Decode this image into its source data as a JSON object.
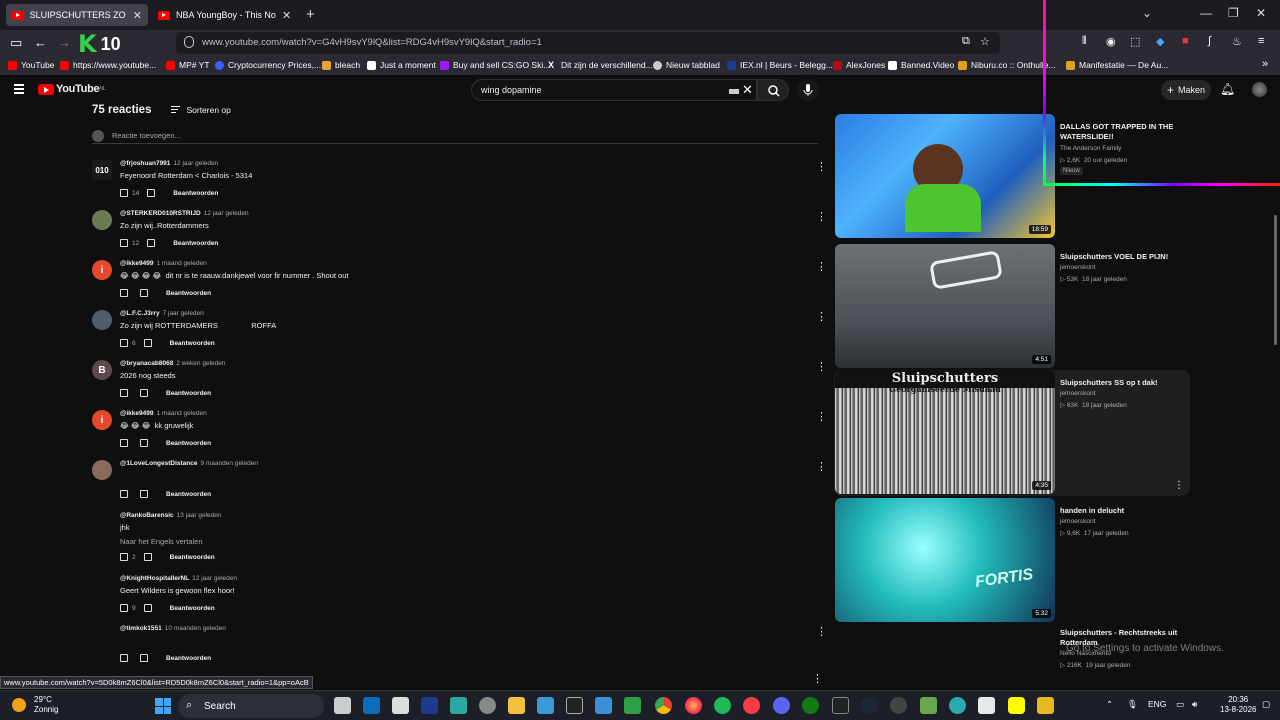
{
  "browser": {
    "tabs": [
      {
        "title": "SLUIPSCHUTTERS ZO ZIJN",
        "active": true
      },
      {
        "title": "NBA YoungBoy - This Not a Song",
        "active": false
      }
    ],
    "url": "www.youtube.com/watch?v=G4vH9svY9lQ&list=RDG4vH9svY9lQ&start_radio=1",
    "k_badge_number": "10",
    "bookmarks": [
      {
        "label": "YouTube",
        "color": "#ff0000"
      },
      {
        "label": "https://www.youtube...",
        "color": "#ff0000"
      },
      {
        "label": "MP# YT",
        "color": "#ff0000"
      },
      {
        "label": "Cryptocurrency Prices,...",
        "color": "#3861fb"
      },
      {
        "label": "bleach",
        "color": "#e8a33a"
      },
      {
        "label": "Just a moment",
        "color": "#ffffff"
      },
      {
        "label": "Buy and sell CS:GO Ski...",
        "color": "#9c1cff"
      },
      {
        "label": "Dit zijn de verschillend...",
        "color": "#ffffff"
      },
      {
        "label": "Nieuw tabblad",
        "color": "#cccccc"
      },
      {
        "label": "IEX.nl | Beurs - Belegg...",
        "color": "#1a3d8f"
      },
      {
        "label": "AlexJones",
        "color": "#b01010"
      },
      {
        "label": "Banned.Video",
        "color": "#ffffff"
      },
      {
        "label": "Niburu.co :: Onthulle...",
        "color": "#e0a020"
      },
      {
        "label": "Manifestatie — De Au...",
        "color": "#e0a020"
      }
    ],
    "hover_url": "www.youtube.com/watch?v=5D0k8mZ6Cl0&list=RD5D0k8mZ6Cl0&start_radio=1&pp=oAcB"
  },
  "youtube": {
    "logo": "YouTube",
    "logo_country": "NL",
    "search_query": "wing dopamine",
    "create_label": "Maken"
  },
  "comments": {
    "count_label": "75 reacties",
    "sort_label": "Sorteren op",
    "add_placeholder": "Reactie toevoegen...",
    "reply_label": "Beantwoorden",
    "items": [
      {
        "handle": "@frjoshuan7991",
        "time": "12 jaar geleden",
        "text": "Feyenoord Rotterdam < Charlois - 5314",
        "likes": "14",
        "avatar": "010",
        "avatar_color": "#1a1a1a"
      },
      {
        "handle": "@STERKERD010RSTRIJD",
        "time": "12 jaar geleden",
        "text": "Zo zijn wij..Rotterdammers",
        "likes": "12",
        "avatar": "",
        "avatar_color": "#6b7a55"
      },
      {
        "handle": "@ikke9499",
        "time": "1 maand geleden",
        "text": "😂 😂 😂 😂  dit nr is te raauw.dankjewel voor fir nummer . Shout out",
        "likes": "",
        "avatar": "i",
        "avatar_color": "#e5482c"
      },
      {
        "handle": "@L.F.C.J3rry",
        "time": "7 jaar geleden",
        "text": "Zo zijn wij ROTTERDAMERS                ROFFA",
        "likes": "6",
        "avatar": "",
        "avatar_color": "#4d5b6b"
      },
      {
        "handle": "@bryanacab8068",
        "time": "2 weken geleden",
        "text": "2026 nog steeds",
        "likes": "",
        "avatar": "B",
        "avatar_color": "#5e4a4a"
      },
      {
        "handle": "@ikke9499",
        "time": "1 maand geleden",
        "text": "😂 😂 😂  kk gruwelijk",
        "likes": "",
        "avatar": "i",
        "avatar_color": "#e5482c"
      },
      {
        "handle": "@1LoveLongestDistance",
        "time": "9 maanden geleden",
        "text": "",
        "likes": "",
        "avatar": "",
        "avatar_color": "#8a6a5a"
      },
      {
        "handle": "@RankoBarensic",
        "time": "13 jaar geleden",
        "text": "jhk",
        "extra": "Naar het Engels vertalen",
        "likes": "2",
        "avatar": "",
        "avatar_color": "#0f0f0f"
      },
      {
        "handle": "@KnightHospitallerNL",
        "time": "12 jaar geleden",
        "text": "Geert Wilders is gewoon flex hoor!",
        "likes": "9",
        "avatar": "",
        "avatar_color": "#0f0f0f"
      },
      {
        "handle": "@timkok1551",
        "time": "10 maanden geleden",
        "text": "",
        "likes": "",
        "avatar": "",
        "avatar_color": "#0f0f0f"
      }
    ]
  },
  "sidebar": {
    "videos": [
      {
        "title": "DALLAS GOT TRAPPED IN THE WATERSLIDE!!",
        "channel": "The Anderson Family",
        "views": "2,6K",
        "age": "20 uur geleden",
        "duration": "18:59",
        "badge": "Nieuw"
      },
      {
        "title": "Sluipschutters VOEL DE PIJN!",
        "channel": "jemoerskont",
        "views": "53K",
        "age": "18 jaar geleden",
        "duration": "4:51",
        "badge": ""
      },
      {
        "title": "Sluipschutters SS op t dak!",
        "channel": "jemoerskont",
        "views": "63K",
        "age": "18 jaar geleden",
        "duration": "4:35",
        "badge": ""
      },
      {
        "title": "handen in delucht",
        "channel": "jemoerskont",
        "views": "9,6K",
        "age": "17 jaar geleden",
        "duration": "5:32",
        "badge": ""
      },
      {
        "title": "Sluipschutters - Rechtstreeks uit Rotterdam",
        "channel": "Nelio Nascimento",
        "views": "216K",
        "age": "19 jaar geleden",
        "duration": "",
        "badge": ""
      }
    ],
    "thumb_text": [
      "Sluipschutters",
      "Georganiseerde Misdaad",
      "FORTIS"
    ]
  },
  "overlay": {
    "activate_windows": "Go to Settings to activate Windows."
  },
  "taskbar": {
    "temperature": "29°C",
    "weather": "Zonnig",
    "search_label": "Search",
    "language": "ENG",
    "time": "20:36",
    "date": "13-8-2026"
  }
}
